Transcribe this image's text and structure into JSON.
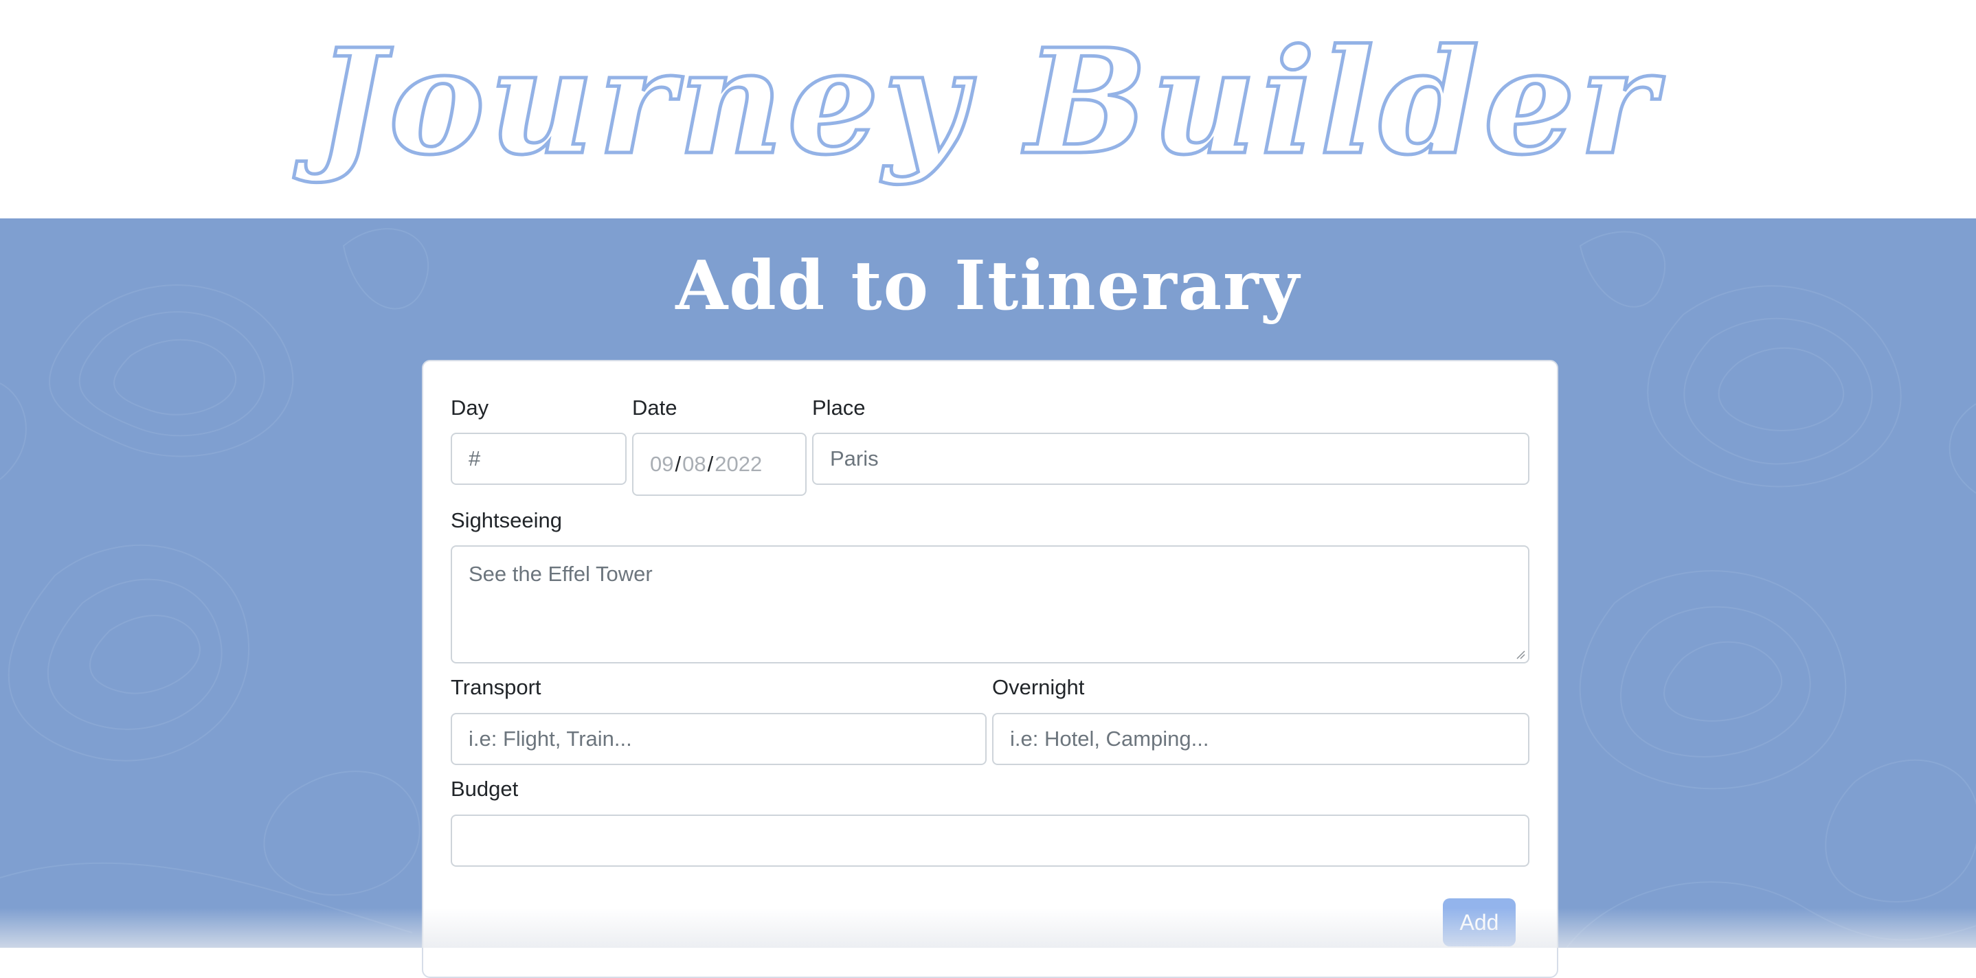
{
  "header": {
    "title": "Journey Builder"
  },
  "main": {
    "section_title": "Add to Itinerary"
  },
  "form": {
    "day": {
      "label": "Day",
      "placeholder": "#",
      "value": ""
    },
    "date": {
      "label": "Date",
      "month": "09",
      "day": "08",
      "year": "2022",
      "separator": "/"
    },
    "place": {
      "label": "Place",
      "placeholder": "Paris",
      "value": ""
    },
    "sightseeing": {
      "label": "Sightseeing",
      "placeholder": "See the Effel Tower",
      "value": ""
    },
    "transport": {
      "label": "Transport",
      "placeholder": "i.e: Flight, Train...",
      "value": ""
    },
    "overnight": {
      "label": "Overnight",
      "placeholder": "i.e: Hotel, Camping...",
      "value": ""
    },
    "budget": {
      "label": "Budget",
      "placeholder": "",
      "value": ""
    },
    "submit_label": "Add"
  },
  "colors": {
    "title_outline": "#93b2e6",
    "background": "#7f9fd0",
    "button": "#93b4ec",
    "card": "#ffffff"
  },
  "icons": {
    "resize": "resize-grip-icon"
  }
}
